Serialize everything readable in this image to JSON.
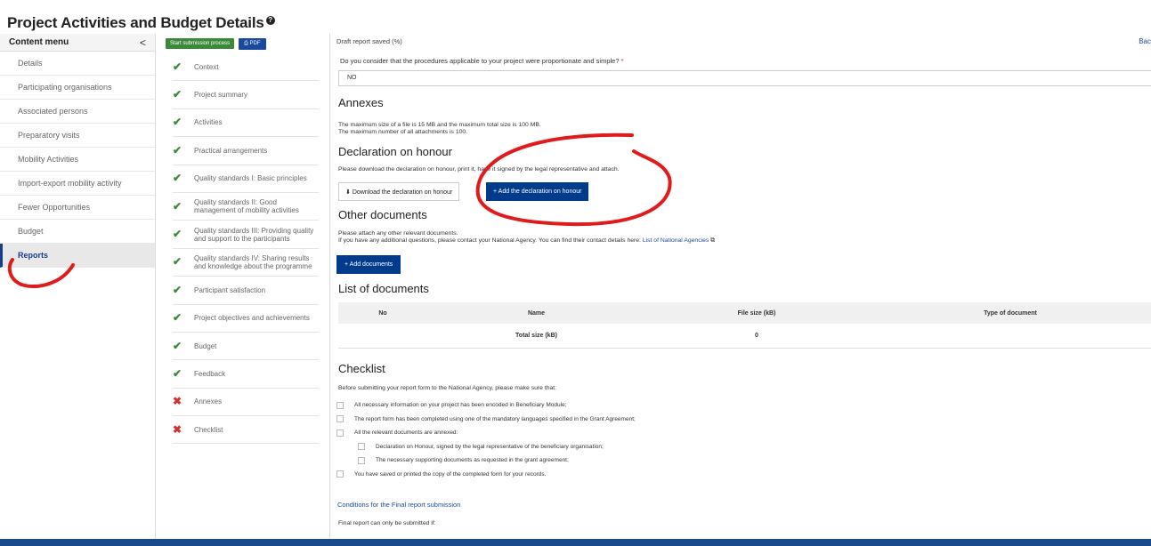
{
  "page": {
    "title": "Project Activities and Budget Details",
    "info_icon_glyph": "?"
  },
  "content_menu": {
    "title": "Content menu",
    "collapse_glyph": "<",
    "items": [
      {
        "label": "Details",
        "active": false
      },
      {
        "label": "Participating organisations",
        "active": false
      },
      {
        "label": "Associated persons",
        "active": false
      },
      {
        "label": "Preparatory visits",
        "active": false
      },
      {
        "label": "Mobility Activities",
        "active": false
      },
      {
        "label": "Import-export mobility activity",
        "active": false
      },
      {
        "label": "Fewer Opportunities",
        "active": false
      },
      {
        "label": "Budget",
        "active": false
      },
      {
        "label": "Reports",
        "active": true
      }
    ]
  },
  "toolbar": {
    "start_label": "Start submission process",
    "pdf_label": "PDF",
    "pdf_icon": "pdf-icon"
  },
  "sections": [
    {
      "label": "Context",
      "status": "complete"
    },
    {
      "label": "Project summary",
      "status": "complete"
    },
    {
      "label": "Activities",
      "status": "complete"
    },
    {
      "label": "Practical arrangements",
      "status": "complete"
    },
    {
      "label": "Quality standards I: Basic principles",
      "status": "complete"
    },
    {
      "label": "Quality standards II: Good management of mobility activities",
      "status": "complete"
    },
    {
      "label": "Quality standards III: Providing quality and support to the participants",
      "status": "complete"
    },
    {
      "label": "Quality standards IV: Sharing results and knowledge about the programme",
      "status": "complete"
    },
    {
      "label": "Participant satisfaction",
      "status": "complete"
    },
    {
      "label": "Project objectives and achievements",
      "status": "complete"
    },
    {
      "label": "Budget",
      "status": "complete"
    },
    {
      "label": "Feedback",
      "status": "complete"
    },
    {
      "label": "Annexes",
      "status": "incomplete"
    },
    {
      "label": "Checklist",
      "status": "incomplete"
    }
  ],
  "status_glyphs": {
    "complete": "✔",
    "incomplete": "✖"
  },
  "colors": {
    "complete": "#3a8a3a",
    "incomplete": "#d32f2f",
    "primary": "#003b8c",
    "annotation": "#e01b1b"
  },
  "main": {
    "draft_label": "Draft report saved (%)",
    "back_label": "Bac",
    "question": "Do you consider that the procedures applicable to your project were proportionate and simple?",
    "required_mark": "*",
    "answer": "NO",
    "annexes_heading": "Annexes",
    "annexes_text_1": "The maximum size of a file is 15 MB and the maximum total size is 100 MB.",
    "annexes_text_2": "The maximum number of all attachments is 100.",
    "declaration_heading": "Declaration on honour",
    "declaration_text": "Please download the declaration on honour, print it, have it signed by the legal representative and attach.",
    "download_label": "Download the declaration on honour",
    "add_declaration_label": "Add the declaration on honour",
    "other_heading": "Other documents",
    "other_text_1": "Please attach any other relevant documents.",
    "other_text_2": "If you have any additional questions, please contact your National Agency. You can find their contact details here:",
    "national_agencies_link": "List of National Agencies",
    "add_documents_label": "Add documents",
    "list_heading": "List of documents",
    "table": {
      "headers": [
        "No",
        "Name",
        "File size (kB)",
        "Type of document"
      ],
      "total_label": "Total size (kB)",
      "total_value": "0"
    },
    "checklist_heading": "Checklist",
    "checklist_intro": "Before submitting your report form to the National Agency, please make sure that:",
    "checklist_items": [
      {
        "label": "All necessary information on your project has been encoded in Beneficiary Module;",
        "sub": false
      },
      {
        "label": "The report form has been completed using one of the mandatory languages specified in the Grant Agreement;",
        "sub": false
      },
      {
        "label": "All the relevant documents are annexed:",
        "sub": false
      },
      {
        "label": "Declaration on Honour, signed by the legal representative of the beneficiary organisation;",
        "sub": true
      },
      {
        "label": "The necessary supporting documents as requested in the grant agreement;",
        "sub": true
      },
      {
        "label": "You have saved or printed the copy of the completed form for your records.",
        "sub": false
      }
    ],
    "conditions_link": "Conditions for the Final report submission",
    "final_text": "Final report can only be submitted if:"
  }
}
